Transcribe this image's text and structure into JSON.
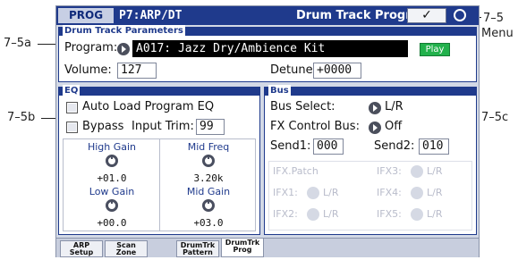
{
  "annotations": {
    "menu_ref": "7–5",
    "menu_label": "Menu",
    "drum_track_ref": "7–5a",
    "eq_ref": "7–5b",
    "bus_ref": "7–5c"
  },
  "header": {
    "mode": "PROG",
    "page": "P7:ARP/DT",
    "title": "Drum Track Program",
    "menu_glyph": "✓"
  },
  "drum_track": {
    "section_label": "Drum Track Parameters",
    "program_label": "Program:",
    "program_value": "A017: Jazz Dry/Ambience Kit",
    "play_label": "Play",
    "volume_label": "Volume:",
    "volume_value": "127",
    "detune_label": "Detune:",
    "detune_value": "+0000"
  },
  "eq": {
    "section_label": "EQ",
    "auto_load_label": "Auto Load Program EQ",
    "bypass_label": "Bypass",
    "input_trim_label": "Input Trim:",
    "input_trim_value": "99",
    "high_gain_label": "High Gain",
    "high_gain_value": "+01.0",
    "mid_freq_label": "Mid Freq",
    "mid_freq_value": "3.20k",
    "low_gain_label": "Low Gain",
    "low_gain_value": "+00.0",
    "mid_gain_label": "Mid Gain",
    "mid_gain_value": "+03.0"
  },
  "bus": {
    "section_label": "Bus",
    "bus_select_label": "Bus Select:",
    "bus_select_value": "L/R",
    "fx_control_label": "FX Control Bus:",
    "fx_control_value": "Off",
    "send1_label": "Send1:",
    "send1_value": "000",
    "send2_label": "Send2:",
    "send2_value": "010",
    "ifx_patch_label": "IFX.Patch",
    "ifx3_label": "IFX3:",
    "ifx3_value": "L/R",
    "ifx1_label": "IFX1:",
    "ifx1_value": "L/R",
    "ifx4_label": "IFX4:",
    "ifx4_value": "L/R",
    "ifx2_label": "IFX2:",
    "ifx2_value": "L/R",
    "ifx5_label": "IFX5:",
    "ifx5_value": "L/R"
  },
  "tabs": [
    {
      "line1": "ARP",
      "line2": "Setup"
    },
    {
      "line1": "Scan",
      "line2": "Zone"
    },
    {
      "line1": "DrumTrk",
      "line2": "Pattern"
    },
    {
      "line1": "DrumTrk",
      "line2": "Prog"
    }
  ]
}
